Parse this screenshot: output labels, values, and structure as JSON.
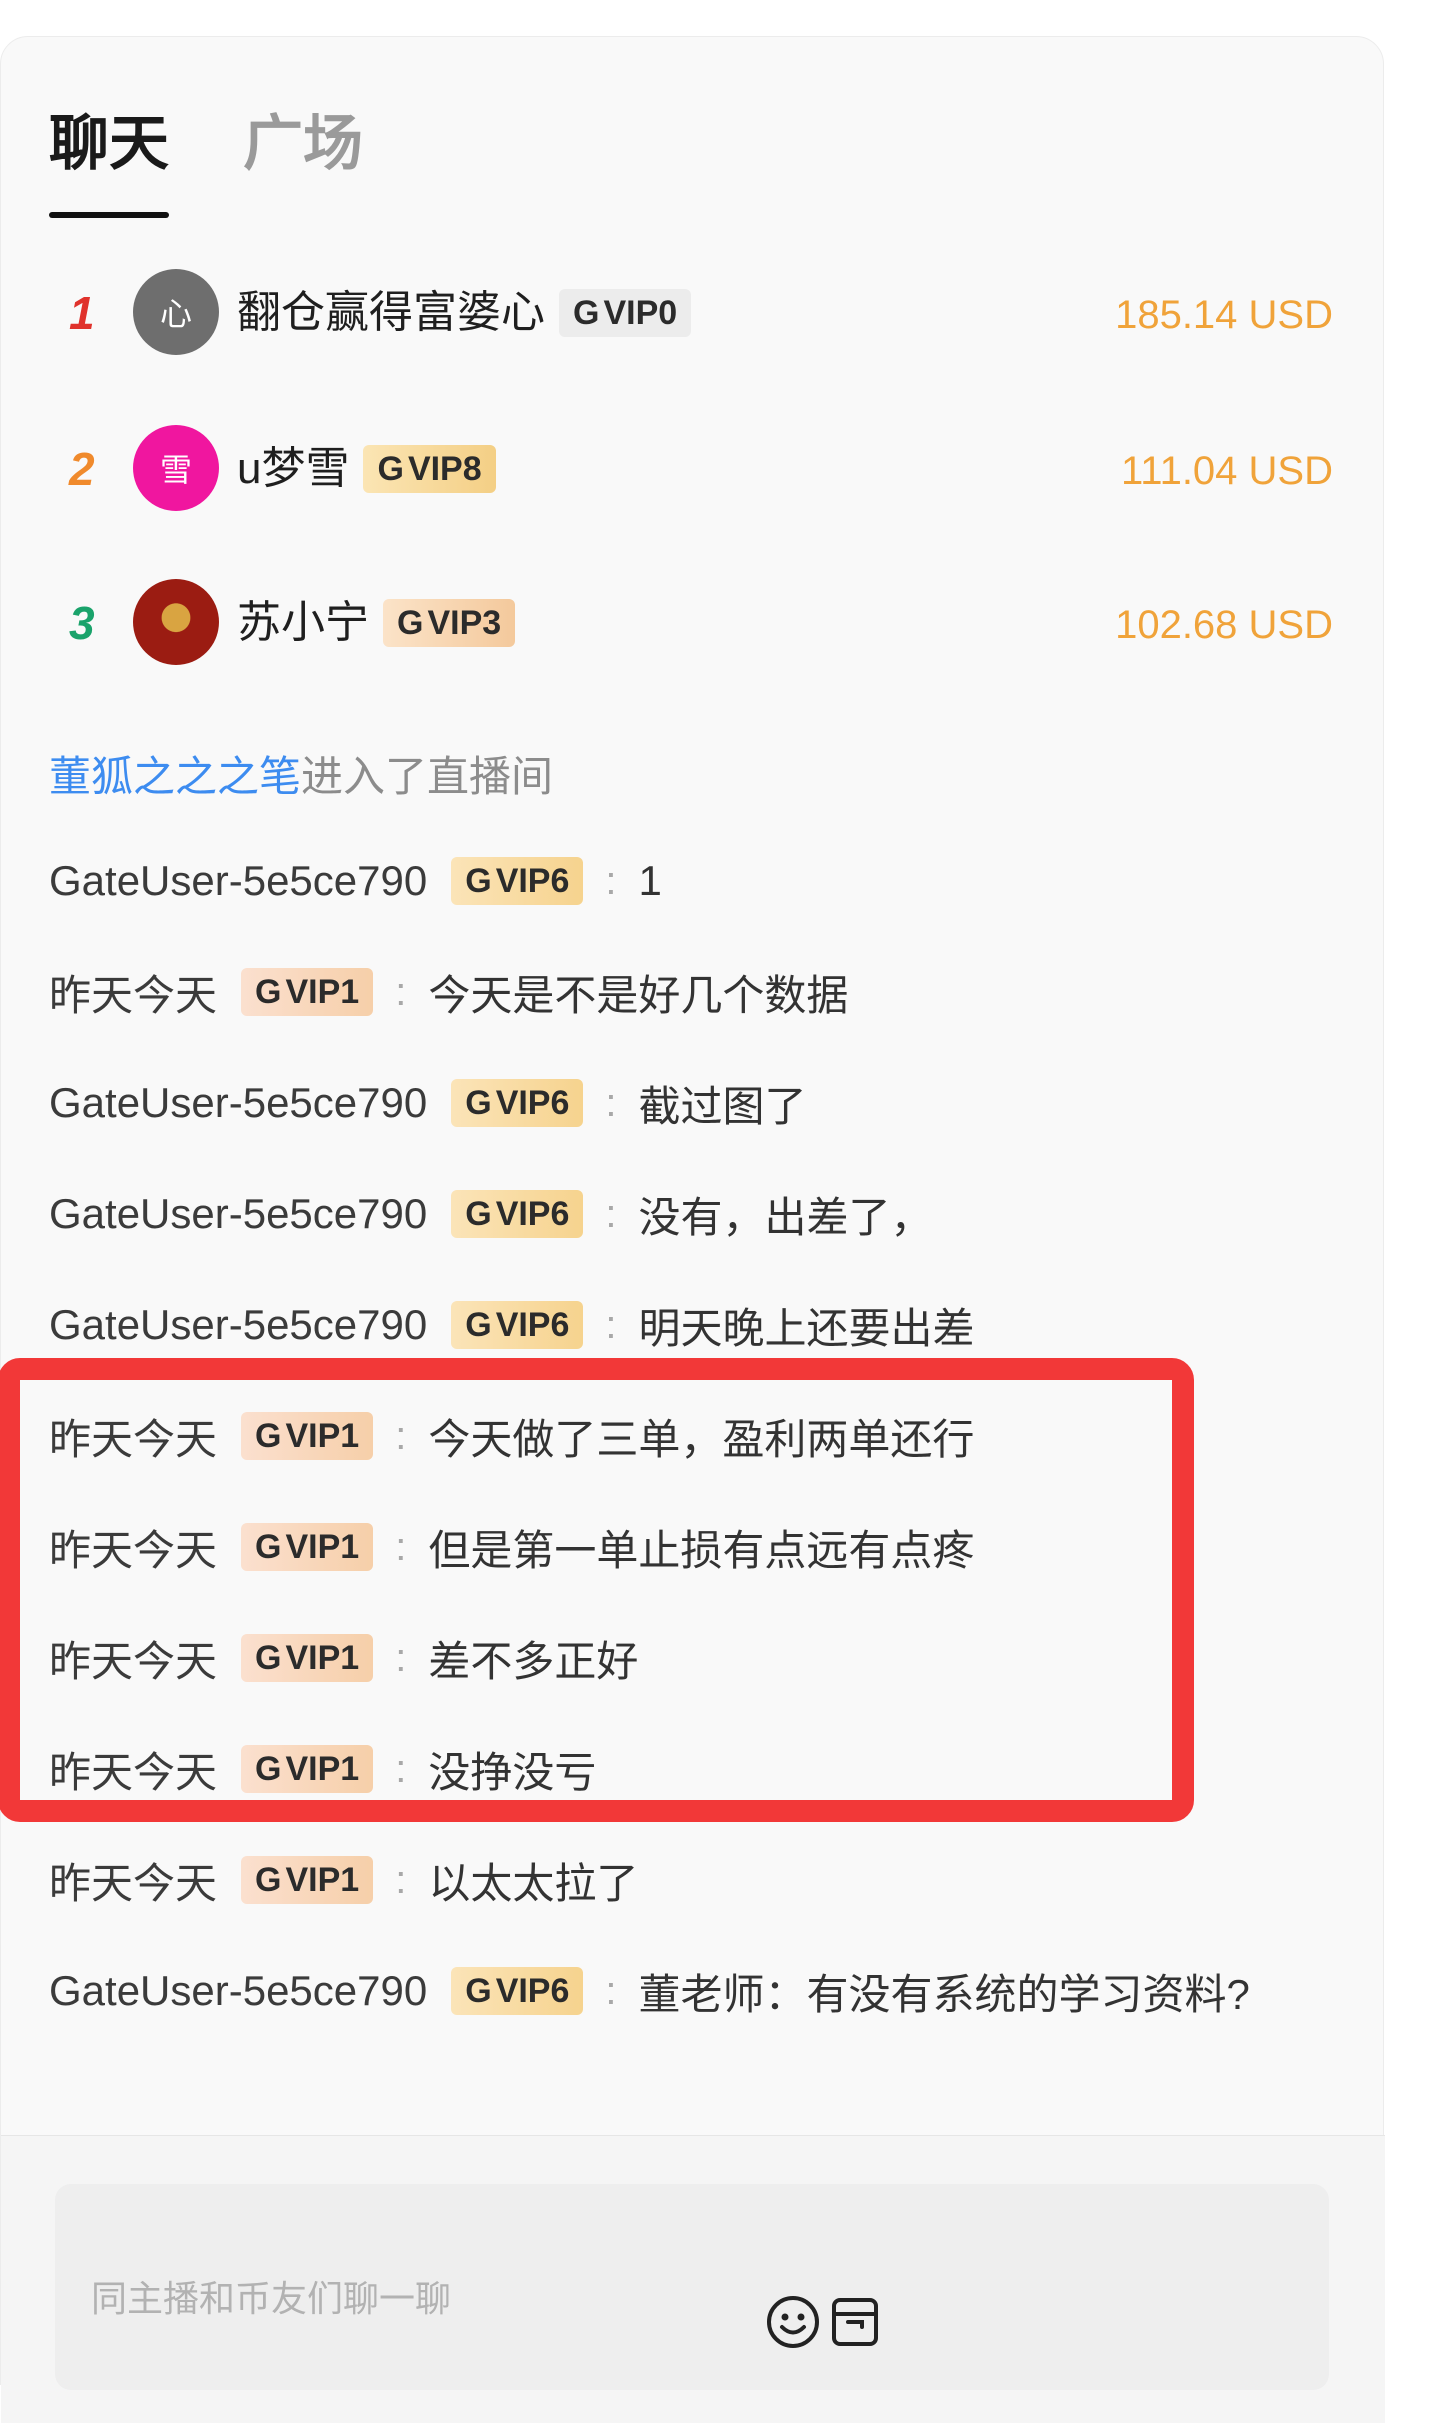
{
  "tabs": [
    {
      "label": "聊天",
      "active": true
    },
    {
      "label": "广场",
      "active": false
    }
  ],
  "leaderboard": [
    {
      "rank": "1",
      "rank_color": "#e0322c",
      "avatar_text": "心",
      "avatar_color": "#6e6e6e",
      "name": "翻仓赢得富婆心",
      "vip": "VIP0",
      "amount": "185.14 USD"
    },
    {
      "rank": "2",
      "rank_color": "#f08a2c",
      "avatar_text": "雪",
      "avatar_color": "#f0169f",
      "name": "u梦雪",
      "vip": "VIP8",
      "amount": "111.04 USD"
    },
    {
      "rank": "3",
      "rank_color": "#1aa36b",
      "avatar_text": "",
      "avatar_color": "#8b1a12",
      "name": "苏小宁",
      "vip": "VIP3",
      "amount": "102.68 USD"
    }
  ],
  "enter_notice": {
    "user": "董狐之之之笔",
    "text": "进入了直播间"
  },
  "messages": [
    {
      "user": "GateUser-5e5ce790",
      "vip": "VIP6",
      "colon": ":",
      "text": "1"
    },
    {
      "user": "昨天今天",
      "vip": "VIP1",
      "colon": ":",
      "text": "今天是不是好几个数据"
    },
    {
      "user": "GateUser-5e5ce790",
      "vip": "VIP6",
      "colon": ":",
      "text": "截过图了"
    },
    {
      "user": "GateUser-5e5ce790",
      "vip": "VIP6",
      "colon": ":",
      "text": "没有，出差了，"
    },
    {
      "user": "GateUser-5e5ce790",
      "vip": "VIP6",
      "colon": ":",
      "text": "明天晚上还要出差"
    },
    {
      "user": "昨天今天",
      "vip": "VIP1",
      "colon": ":",
      "text": "今天做了三单，盈利两单还行"
    },
    {
      "user": "昨天今天",
      "vip": "VIP1",
      "colon": ":",
      "text": "但是第一单止损有点远有点疼"
    },
    {
      "user": "昨天今天",
      "vip": "VIP1",
      "colon": ":",
      "text": "差不多正好"
    },
    {
      "user": "昨天今天",
      "vip": "VIP1",
      "colon": ":",
      "text": "没挣没亏"
    },
    {
      "user": "昨天今天",
      "vip": "VIP1",
      "colon": ":",
      "text": "以太太拉了"
    },
    {
      "user": "GateUser-5e5ce790",
      "vip": "VIP6",
      "colon": ":",
      "text": "董老师：有没有系统的学习资料?"
    }
  ],
  "input": {
    "placeholder": "同主播和币友们聊一聊"
  },
  "icons": {
    "vip_glyph": "G",
    "emoji": "emoji-icon",
    "gift": "gift-box-icon"
  },
  "colors": {
    "amount": "#f0a33a",
    "enter_user": "#3d8cf0",
    "highlight": "#f23838"
  }
}
